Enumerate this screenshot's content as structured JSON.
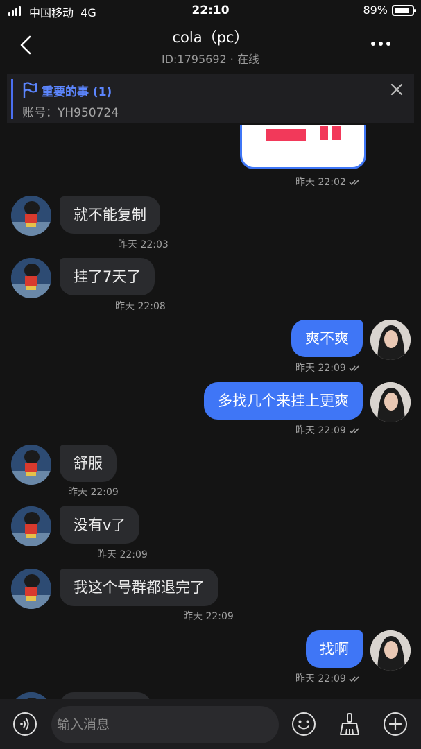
{
  "status_bar": {
    "carrier": "中国移动",
    "network": "4G",
    "time": "22:10",
    "battery_percent": "89%",
    "battery_level": 0.89
  },
  "header": {
    "title": "cola（pc）",
    "subtitle": "ID:1795692 · 在线",
    "back_icon": "chevron-left-icon",
    "more_icon": "more-horizontal-icon"
  },
  "pinned": {
    "title": "重要的事 (1)",
    "account": "账号：YH950724",
    "flag_icon": "flag-icon",
    "close_icon": "close-icon"
  },
  "messages": [
    {
      "from": "me",
      "type": "image",
      "time": "昨天 22:02",
      "read": true
    },
    {
      "from": "them",
      "text": "就不能复制",
      "time": "昨天 22:03"
    },
    {
      "from": "them",
      "text": "挂了7天了",
      "time": "昨天 22:08"
    },
    {
      "from": "me",
      "text": "爽不爽",
      "time": "昨天 22:09",
      "read": true
    },
    {
      "from": "me",
      "text": "多找几个来挂上更爽",
      "time": "昨天 22:09",
      "read": true
    },
    {
      "from": "them",
      "text": "舒服",
      "time": "昨天 22:09"
    },
    {
      "from": "them",
      "text": "没有v了",
      "time": "昨天 22:09"
    },
    {
      "from": "them",
      "text": "我这个号群都退完了",
      "time": "昨天 22:09"
    },
    {
      "from": "me",
      "text": "找啊",
      "time": "昨天 22:09",
      "read": true
    }
  ],
  "input": {
    "placeholder": "输入消息",
    "voice_icon": "voice-icon",
    "emoji_icon": "emoji-icon",
    "broom_icon": "broom-icon",
    "add_icon": "plus-circle-icon"
  },
  "colors": {
    "background": "#141414",
    "outgoing_bubble": "#3f76f6",
    "incoming_bubble": "#2a2b2e",
    "pinned_accent": "#5c86ff"
  }
}
